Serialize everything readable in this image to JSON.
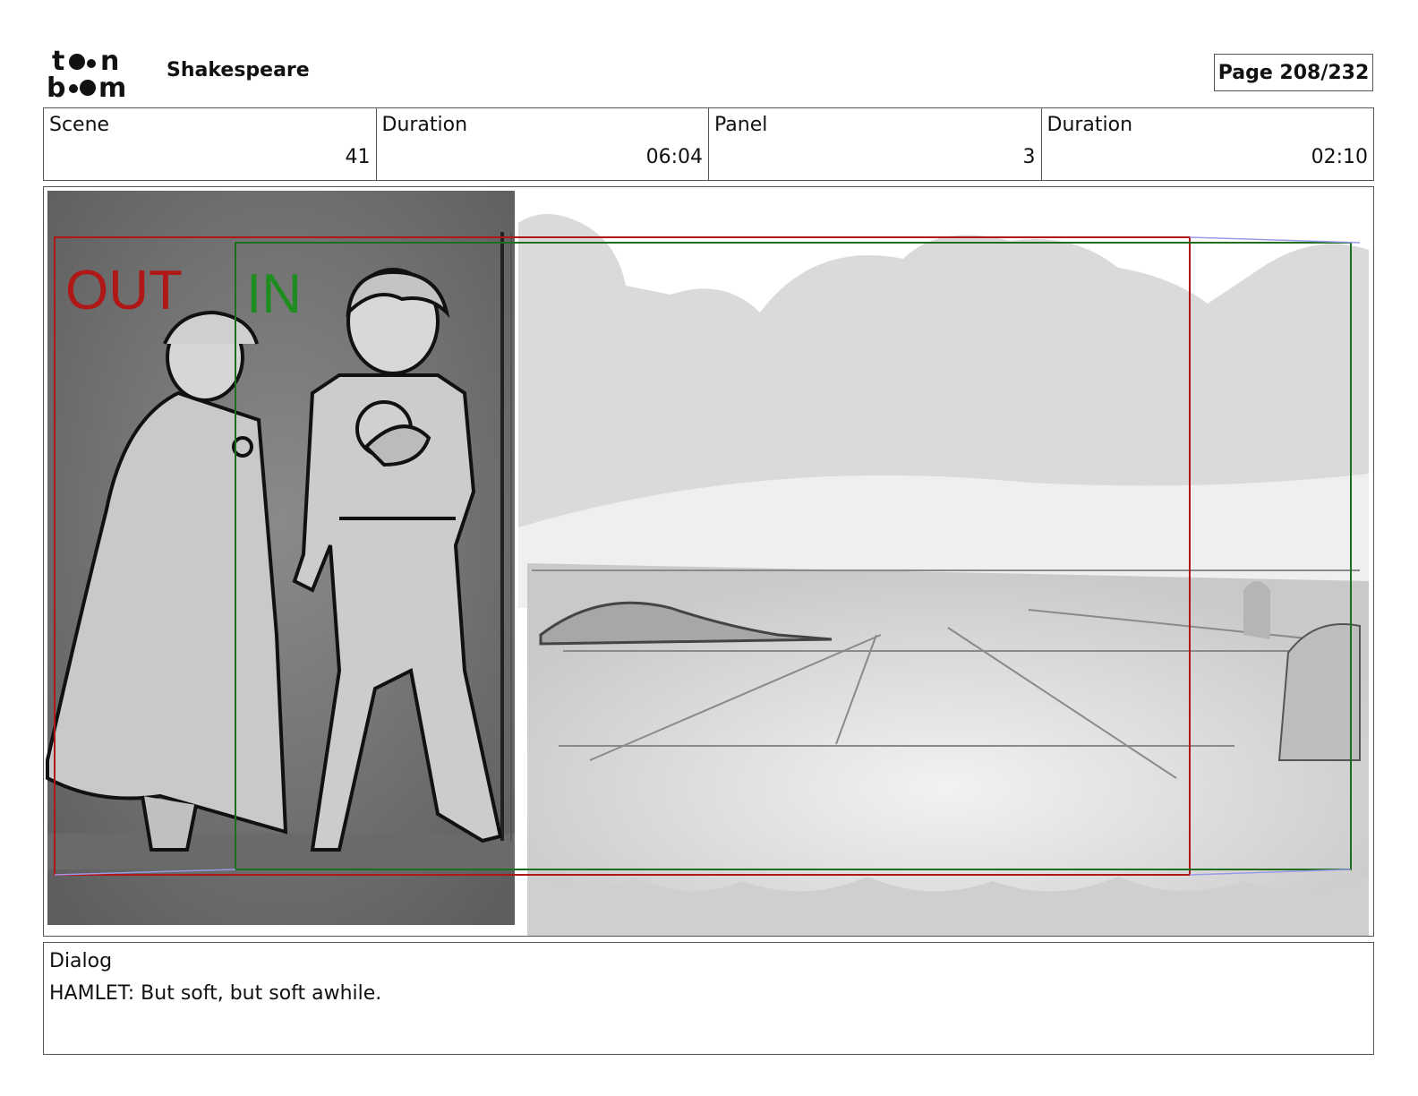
{
  "header": {
    "logo_text": "toon boom",
    "project_title": "Shakespeare",
    "page_label": "Page 208/232"
  },
  "info": {
    "scene_label": "Scene",
    "scene_value": "41",
    "scene_duration_label": "Duration",
    "scene_duration_value": "06:04",
    "panel_label": "Panel",
    "panel_value": "3",
    "panel_duration_label": "Duration",
    "panel_duration_value": "02:10"
  },
  "panel": {
    "out_label": "OUT",
    "in_label": "IN",
    "out_color": "#b01818",
    "in_color": "#1e8c1e"
  },
  "dialog": {
    "label": "Dialog",
    "text": "HAMLET: But soft, but soft awhile."
  }
}
